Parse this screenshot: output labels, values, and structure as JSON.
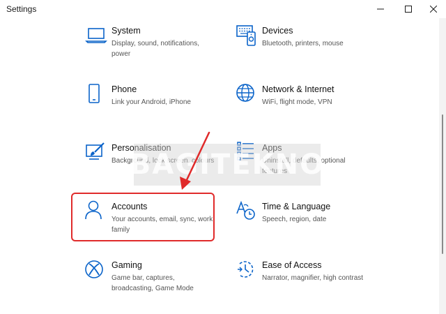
{
  "window": {
    "title": "Settings"
  },
  "watermark": "BAGITEKNO",
  "tiles": [
    {
      "name": "System",
      "desc": "Display, sound, notifications, power",
      "icon": "laptop-icon"
    },
    {
      "name": "Devices",
      "desc": "Bluetooth, printers, mouse",
      "icon": "devices-icon"
    },
    {
      "name": "Phone",
      "desc": "Link your Android, iPhone",
      "icon": "phone-icon"
    },
    {
      "name": "Network & Internet",
      "desc": "WiFi, flight mode, VPN",
      "icon": "globe-icon"
    },
    {
      "name": "Personalisation",
      "desc": "Background, lock screen, colours",
      "icon": "paintbrush-icon"
    },
    {
      "name": "Apps",
      "desc": "Uninstall, defaults, optional features",
      "icon": "apps-list-icon"
    },
    {
      "name": "Accounts",
      "desc": "Your accounts, email, sync, work, family",
      "icon": "person-icon"
    },
    {
      "name": "Time & Language",
      "desc": "Speech, region, date",
      "icon": "time-language-icon"
    },
    {
      "name": "Gaming",
      "desc": "Game bar, captures, broadcasting, Game Mode",
      "icon": "xbox-icon"
    },
    {
      "name": "Ease of Access",
      "desc": "Narrator, magnifier, high contrast",
      "icon": "ease-of-access-icon"
    }
  ],
  "colors": {
    "accent": "#0a63c9",
    "highlight": "#e02a2a"
  }
}
